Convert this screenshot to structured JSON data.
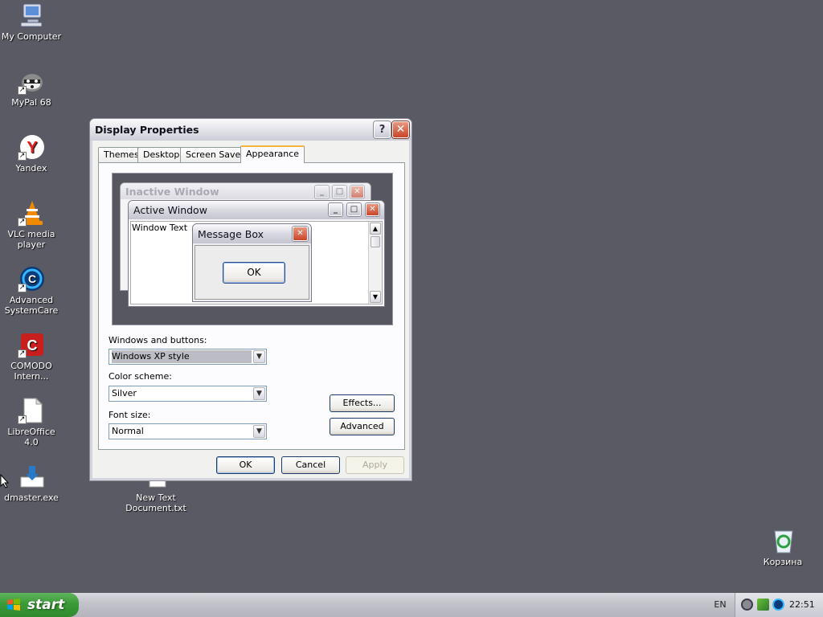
{
  "desktop": {
    "icons": [
      {
        "label": "My Computer",
        "icon": "computer-icon"
      },
      {
        "label": "MyPal 68",
        "icon": "raccoon-icon"
      },
      {
        "label": "Yandex",
        "icon": "yandex-icon"
      },
      {
        "label": "VLC media player",
        "icon": "vlc-icon"
      },
      {
        "label": "Advanced SystemCare",
        "icon": "systemcare-icon"
      },
      {
        "label": "COMODO Intern...",
        "icon": "comodo-icon"
      },
      {
        "label": "LibreOffice 4.0",
        "icon": "document-icon"
      },
      {
        "label": "dmaster.exe",
        "icon": "download-icon"
      },
      {
        "label": "New Text Document.txt",
        "icon": "text-file-icon"
      },
      {
        "label": "Корзина",
        "icon": "recycle-bin-icon"
      }
    ]
  },
  "dialog": {
    "title": "Display Properties",
    "help_symbol": "?",
    "close_symbol": "✕",
    "tabs": [
      "Themes",
      "Desktop",
      "Screen Saver",
      "Appearance"
    ],
    "active_tab": "Appearance",
    "preview": {
      "inactive_title": "Inactive Window",
      "active_title": "Active Window",
      "window_text": "Window Text",
      "message_title": "Message Box",
      "message_ok": "OK"
    },
    "windows_buttons": {
      "label": "Windows and buttons:",
      "value": "Windows XP style"
    },
    "color_scheme": {
      "label": "Color scheme:",
      "value": "Silver"
    },
    "font_size": {
      "label": "Font size:",
      "value": "Normal"
    },
    "effects_label": "Effects...",
    "advanced_label": "Advanced",
    "ok_label": "OK",
    "cancel_label": "Cancel",
    "apply_label": "Apply"
  },
  "taskbar": {
    "start_label": "start",
    "language": "EN",
    "clock": "22:51"
  },
  "colors": {
    "desktop_bg": "#5a5a64",
    "tab_accent": "#f2b43d",
    "start_green": "#3b9a37",
    "close_red": "#c9452a"
  }
}
